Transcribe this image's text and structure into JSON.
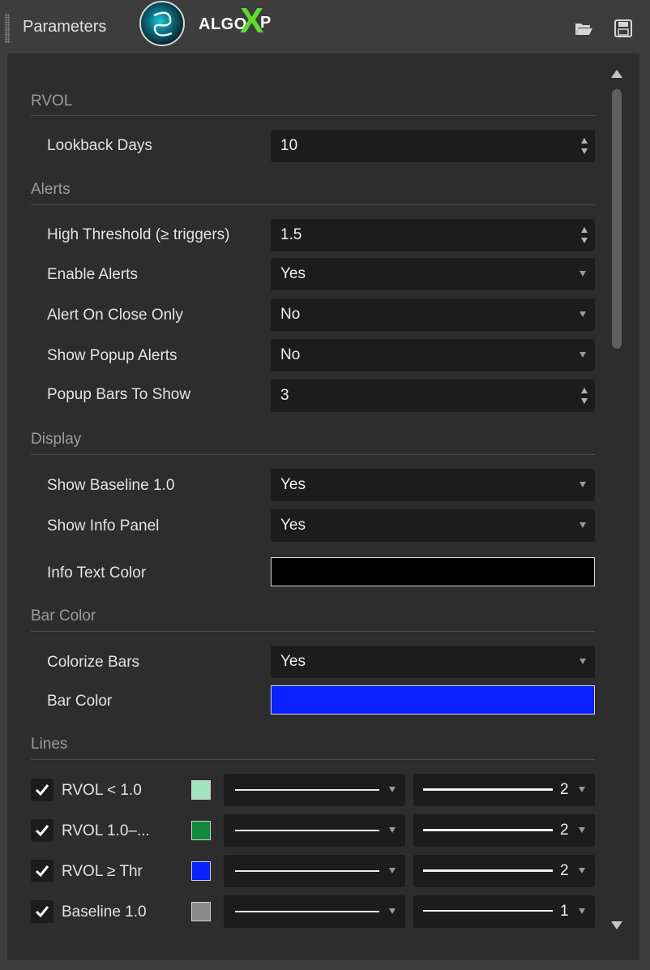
{
  "window": {
    "title": "Parameters",
    "logo_text": "ALGO",
    "logo_x": "X",
    "logo_p": "P"
  },
  "sections": {
    "rvol": "RVOL",
    "alerts": "Alerts",
    "display": "Display",
    "bar_color": "Bar Color",
    "lines": "Lines"
  },
  "params": {
    "lookback_days": {
      "label": "Lookback Days",
      "value": "10"
    },
    "high_threshold": {
      "label": "High Threshold (≥ triggers)",
      "value": "1.5"
    },
    "enable_alerts": {
      "label": "Enable Alerts",
      "value": "Yes"
    },
    "alert_on_close": {
      "label": "Alert On Close Only",
      "value": "No"
    },
    "show_popup": {
      "label": "Show Popup Alerts",
      "value": "No"
    },
    "popup_bars": {
      "label": "Popup Bars To Show",
      "value": "3"
    },
    "show_baseline": {
      "label": "Show Baseline 1.0",
      "value": "Yes"
    },
    "show_info_panel": {
      "label": "Show Info Panel",
      "value": "Yes"
    },
    "info_text_color": {
      "label": "Info Text Color",
      "color": "#000000"
    },
    "colorize_bars": {
      "label": "Colorize Bars",
      "value": "Yes"
    },
    "bar_color": {
      "label": "Bar Color",
      "color": "#0a22ff"
    }
  },
  "lines": [
    {
      "label": "RVOL < 1.0",
      "checked": true,
      "color": "#a3e4c1",
      "width": "2"
    },
    {
      "label": "RVOL 1.0–...",
      "checked": true,
      "color": "#0f8a3c",
      "width": "2"
    },
    {
      "label": "RVOL ≥ Thr",
      "checked": true,
      "color": "#0a22ff",
      "width": "2"
    },
    {
      "label": "Baseline 1.0",
      "checked": true,
      "color": "#8c8c8c",
      "width": "1"
    }
  ],
  "icons": {
    "load": "folder-open-icon",
    "save": "floppy-save-icon"
  }
}
